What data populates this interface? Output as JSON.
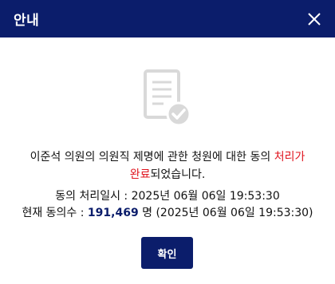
{
  "header": {
    "title": "안내"
  },
  "message": {
    "part1": "이준석 의원의 의원직 제명에 관한 청원에 대한 동의 ",
    "status_highlight_1": "처리가",
    "status_highlight_2": "완료",
    "part2": "되었습니다."
  },
  "info": {
    "processed_label": "동의 처리일시 : ",
    "processed_datetime": "2025년 06월 06일 19:53:30",
    "count_label": "현재 동의수 : ",
    "count_value": "191,469",
    "count_unit": " 명 ",
    "count_datetime": "(2025년 06월 06일 19:53:30)"
  },
  "buttons": {
    "confirm_label": "확인"
  },
  "icons": {
    "close": "close-icon",
    "document": "document-check-icon"
  },
  "colors": {
    "header_bg": "#0b1d6b",
    "highlight_red": "#e0141e",
    "icon_gray": "#d9d9d9"
  }
}
